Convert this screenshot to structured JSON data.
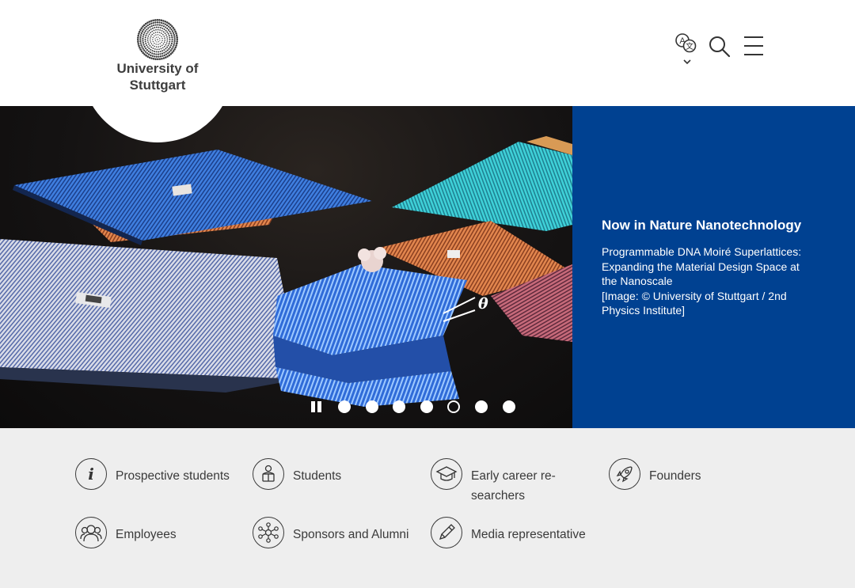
{
  "header": {
    "logo_line1": "University of",
    "logo_line2": "Stuttgart",
    "tools": [
      {
        "name": "language-icon"
      },
      {
        "name": "search-icon"
      },
      {
        "name": "menu-icon"
      }
    ]
  },
  "hero": {
    "title": "Now in Nature Nanotechnology",
    "text_lines": [
      "Programmable DNA Moiré Superlattices:",
      "Expanding the Material Design Space at",
      "the Nanoscale",
      "[Image: © University of Stuttgart / 2nd",
      "Physics Institute]"
    ],
    "image_annotation": "θ",
    "slide_count": 7,
    "active_slide": 4
  },
  "target_groups": [
    {
      "label": "Prospective students",
      "icon": "info-icon"
    },
    {
      "label": "Students",
      "icon": "student-icon"
    },
    {
      "label": "Early career re-\nsearchers",
      "icon": "graduation-cap-icon"
    },
    {
      "label": "Founders",
      "icon": "rocket-icon"
    },
    {
      "label": "Employees",
      "icon": "people-icon"
    },
    {
      "label": "Sponsors and Alumni",
      "icon": "network-icon"
    },
    {
      "label": "Media representative",
      "icon": "pencil-icon"
    }
  ],
  "colors": {
    "panel_blue": "#004191",
    "links_background": "#eeeeee",
    "text_dark": "#3a3a3a"
  }
}
